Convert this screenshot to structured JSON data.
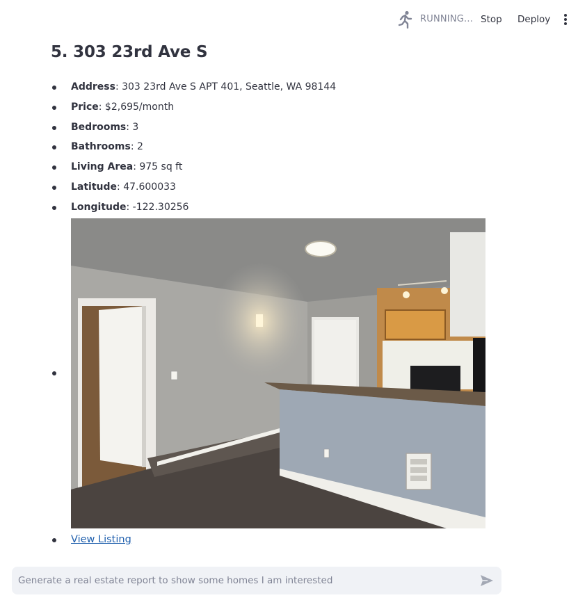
{
  "toolbar": {
    "status": "RUNNING...",
    "stop_label": "Stop",
    "deploy_label": "Deploy",
    "running_icon": "running-man-icon",
    "menu_icon": "more-vertical-icon"
  },
  "listing": {
    "title": "5. 303 23rd Ave S",
    "details": [
      {
        "label": "Address",
        "value": ": 303 23rd Ave S APT 401, Seattle, WA 98144"
      },
      {
        "label": "Price",
        "value": ": $2,695/month"
      },
      {
        "label": "Bedrooms",
        "value": ": 3"
      },
      {
        "label": "Bathrooms",
        "value": ": 2"
      },
      {
        "label": "Living Area",
        "value": ": 975 sq ft"
      },
      {
        "label": "Latitude",
        "value": ": 47.600033"
      },
      {
        "label": "Longitude",
        "value": ": -122.30256"
      }
    ],
    "link_text": "View Listing"
  },
  "chat": {
    "placeholder": "Generate a real estate report to show some homes I am interested",
    "send_icon": "send-icon"
  },
  "colors": {
    "link": "#1f5fad",
    "text": "#31333f",
    "muted": "#808495",
    "input_bg": "#f0f2f6"
  }
}
